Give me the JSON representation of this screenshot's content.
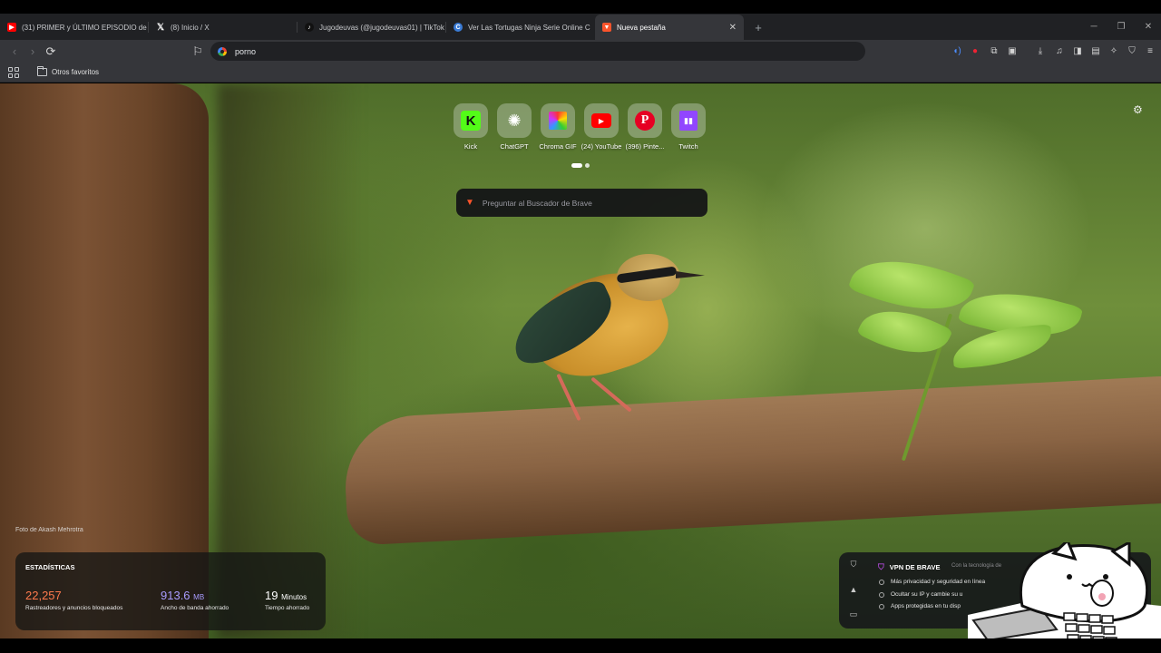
{
  "tabs": [
    {
      "title": "(31) PRIMER y ÚLTIMO EPISODIO de",
      "icon": "youtube-icon",
      "color": "#ff0000"
    },
    {
      "title": "(8) Inicio / X",
      "icon": "x-icon",
      "color": "#000000"
    },
    {
      "title": "Jugodeuvas (@jugodeuvas01) | TikTok",
      "icon": "tiktok-icon",
      "color": "#111111"
    },
    {
      "title": "Ver Las Tortugas Ninja Serie Online C",
      "icon": "site-icon",
      "color": "#3a7bd5"
    },
    {
      "title": "Nueva pestaña",
      "icon": "brave-icon",
      "color": "#fb542b",
      "active": true
    }
  ],
  "toolbar": {
    "address": "porno"
  },
  "bookmarks": {
    "folder": "Otros favoritos"
  },
  "newtab": {
    "top_sites": [
      {
        "label": "Kick",
        "icon": "kick-icon",
        "color": "#53fc18"
      },
      {
        "label": "ChatGPT",
        "icon": "chatgpt-icon",
        "color": "#ffffff"
      },
      {
        "label": "Chroma GIF",
        "icon": "chroma-icon",
        "color": "#ff8800"
      },
      {
        "label": "(24) YouTube",
        "icon": "youtube-icon",
        "color": "#ff0000"
      },
      {
        "label": "(396) Pinte...",
        "icon": "pinterest-icon",
        "color": "#e60023"
      },
      {
        "label": "Twitch",
        "icon": "twitch-icon",
        "color": "#9146ff"
      }
    ],
    "search_placeholder": "Preguntar al Buscador de Brave",
    "photo_credit": "Foto de Akash Mehrotra",
    "stats": {
      "title": "ESTADÍSTICAS",
      "trackers_value": "22,257",
      "trackers_label": "Rastreadores y anuncios bloqueados",
      "trackers_color": "#ff7a4d",
      "bandwidth_value": "913.6",
      "bandwidth_unit": "MB",
      "bandwidth_label": "Ancho de banda ahorrado",
      "bandwidth_color": "#a99cff",
      "time_value": "19",
      "time_unit": "Minutos",
      "time_label": "Tiempo ahorrado"
    },
    "vpn": {
      "title": "VPN DE BRAVE",
      "subtitle": "Con la tecnología de",
      "items": [
        "Más privacidad y seguridad en línea",
        "Ocultar su IP y cambie su u",
        "Apps protegidas en tu disp"
      ]
    }
  }
}
